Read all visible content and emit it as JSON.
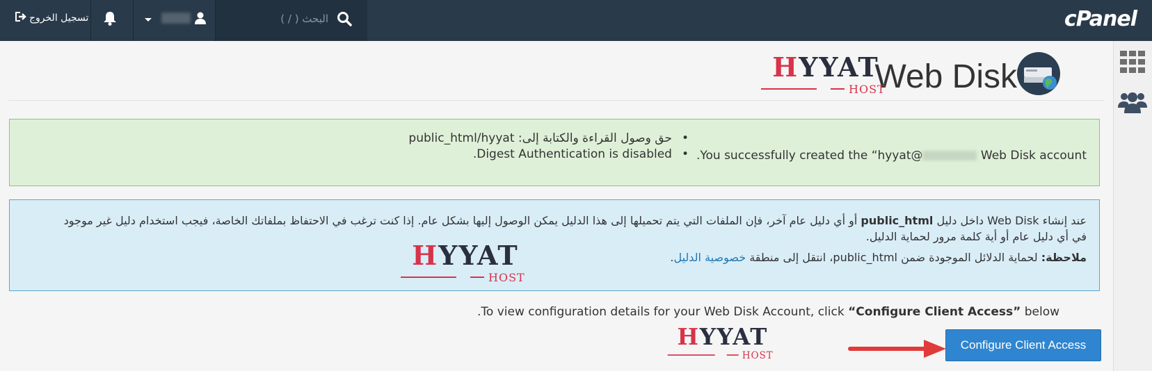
{
  "topbar": {
    "logo": "cPanel",
    "search_placeholder": "البحث ( / )",
    "logout_label": "تسجيل الخروج"
  },
  "page": {
    "title": "Web Disk",
    "brand_main": "YYAT",
    "brand_h": "H",
    "brand_sub": "HOST"
  },
  "success": {
    "message_prefix": "You successfully created the “hyyat@",
    "message_suffix": " Web Disk account.",
    "items": [
      "حق وصول القراءة والكتابة إلى: public_html/hyyat",
      "Digest Authentication is disabled."
    ]
  },
  "info": {
    "p1_a": "عند إنشاء Web Disk داخل دليل ",
    "p1_bold": "public_html",
    "p1_b": " أو أي دليل عام آخر، فإن الملفات التي يتم تحميلها إلى هذا الدليل يمكن الوصول إليها بشكل عام. إذا كنت ترغب في الاحتفاظ بملفاتك الخاصة، فيجب استخدام دليل غير موجود في أي دليل عام أو أية كلمة مرور لحماية الدليل.",
    "note_label": "ملاحظة:",
    "note_text": " لحماية الدلائل الموجودة ضمن public_html، انتقل إلى منطقة ",
    "note_link": "خصوصية الدليل",
    "note_end": "."
  },
  "configure": {
    "text_a": "To view configuration details for your Web Disk Account, click ",
    "text_bold": "“Configure Client Access”",
    "text_b": " below.",
    "button_label": "Configure Client Access"
  }
}
